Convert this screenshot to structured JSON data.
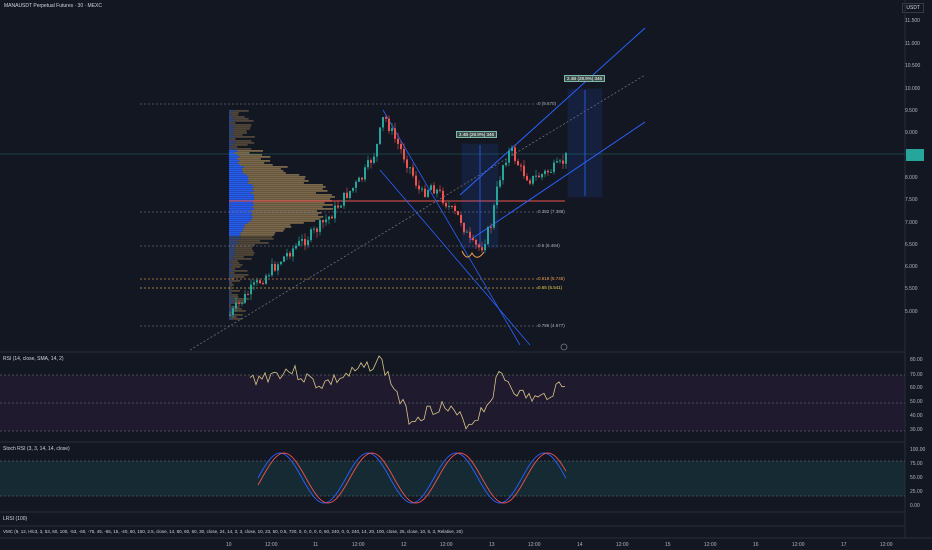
{
  "header": {
    "title": "MANAUSDT Perpetual Futures · 30 · MEXC",
    "currency": "USDT"
  },
  "price_axis": {
    "ticks": [
      "11.500",
      "11.000",
      "10.500",
      "10.000",
      "9.500",
      "9.000",
      "8.500",
      "8.000",
      "7.500",
      "7.000",
      "6.500",
      "6.000",
      "5.500",
      "5.000"
    ],
    "last_price": ""
  },
  "fib_labels": [
    {
      "text": "0 (9.670)",
      "color": "#787b86"
    },
    {
      "text": "0.382 (7.388)",
      "color": "#787b86"
    },
    {
      "text": "0.5 (6.494)",
      "color": "#787b86"
    },
    {
      "text": "0.618 (5.745)",
      "color": "#f0a050"
    },
    {
      "text": "0.65 (5.541)",
      "color": "#f0d050"
    },
    {
      "text": "0.786 (4.677)",
      "color": "#787b86"
    }
  ],
  "measures": {
    "left": "2.4B (28.9%) 346",
    "right": "2.4B (28.9%) 346"
  },
  "rsi": {
    "title": "RSI (14, close, SMA, 14, 2)",
    "ticks": [
      "80.00",
      "70.00",
      "60.00",
      "50.00",
      "40.00",
      "30.00"
    ]
  },
  "stoch": {
    "title": "Stoch RSI (3, 3, 14, 14, close)",
    "ticks": [
      "100.00",
      "75.00",
      "50.00",
      "25.00",
      "0.00"
    ]
  },
  "lrsi": {
    "title": "LRSI (100)"
  },
  "vmc": {
    "title": "VMC (9, 12, Hlc3, 3, 53, 60, 100, -53, -60, -75, 45, -65, 15, -40, 60, 150, 2.5, close, 14, 80, 60, 60, 30, close, 24, 14, 3, 3, close, 10, 23, 50, 0.5, 720, 0, 0, 0, 0, 0, 60, 240, 0, 0, 240, 14, 20, 100, close, 25, close, 10, 5, 3, Relative, 20)"
  },
  "time_axis": {
    "ticks": [
      "10",
      "12:00",
      "11",
      "12:00",
      "12",
      "12:00",
      "13",
      "12:00",
      "14",
      "12:00",
      "15",
      "12:00",
      "16",
      "12:00",
      "17",
      "12:00"
    ]
  },
  "colors": {
    "background": "#131722",
    "up": "#26a69a",
    "down": "#ef5350",
    "channel": "#2962ff",
    "rsi_line": "#d8c68a",
    "stoch_k": "#2962ff",
    "stoch_d": "#ef5350"
  },
  "icons": {
    "settings": "gear-icon"
  }
}
